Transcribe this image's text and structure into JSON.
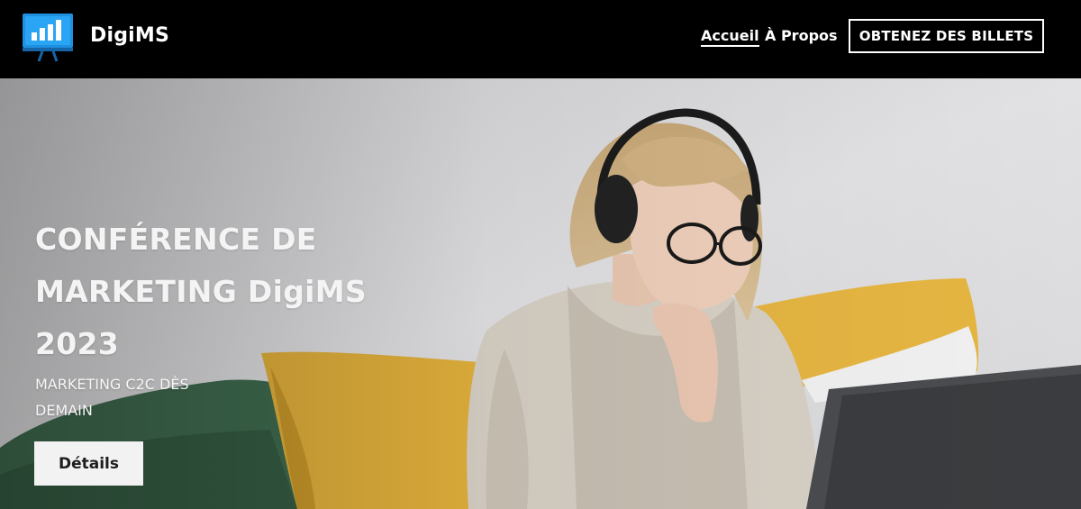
{
  "header": {
    "brand": "DigiMS",
    "logo_icon": "presentation-board-icon",
    "nav": [
      {
        "label": "Accueil",
        "active": true
      },
      {
        "label": "À Propos",
        "active": false
      }
    ],
    "cta_label": "OBTENEZ DES BILLETS"
  },
  "hero": {
    "title_line1": "CONFÉRENCE DE",
    "title_line2": "MARKETING DigiMS",
    "title_line3": "2023",
    "subtitle_line1": "MARKETING C2C DÈS",
    "subtitle_line2": "DEMAIN",
    "button_label": "Détails",
    "image_subject": "woman-with-headphones-laptop-photo"
  },
  "colors": {
    "header_bg": "#000000",
    "logo_blue": "#1f8fe0",
    "accent_yellow": "#e6b43c",
    "pillow_green": "#3f6b4f",
    "button_bg": "#f2f2f2"
  }
}
